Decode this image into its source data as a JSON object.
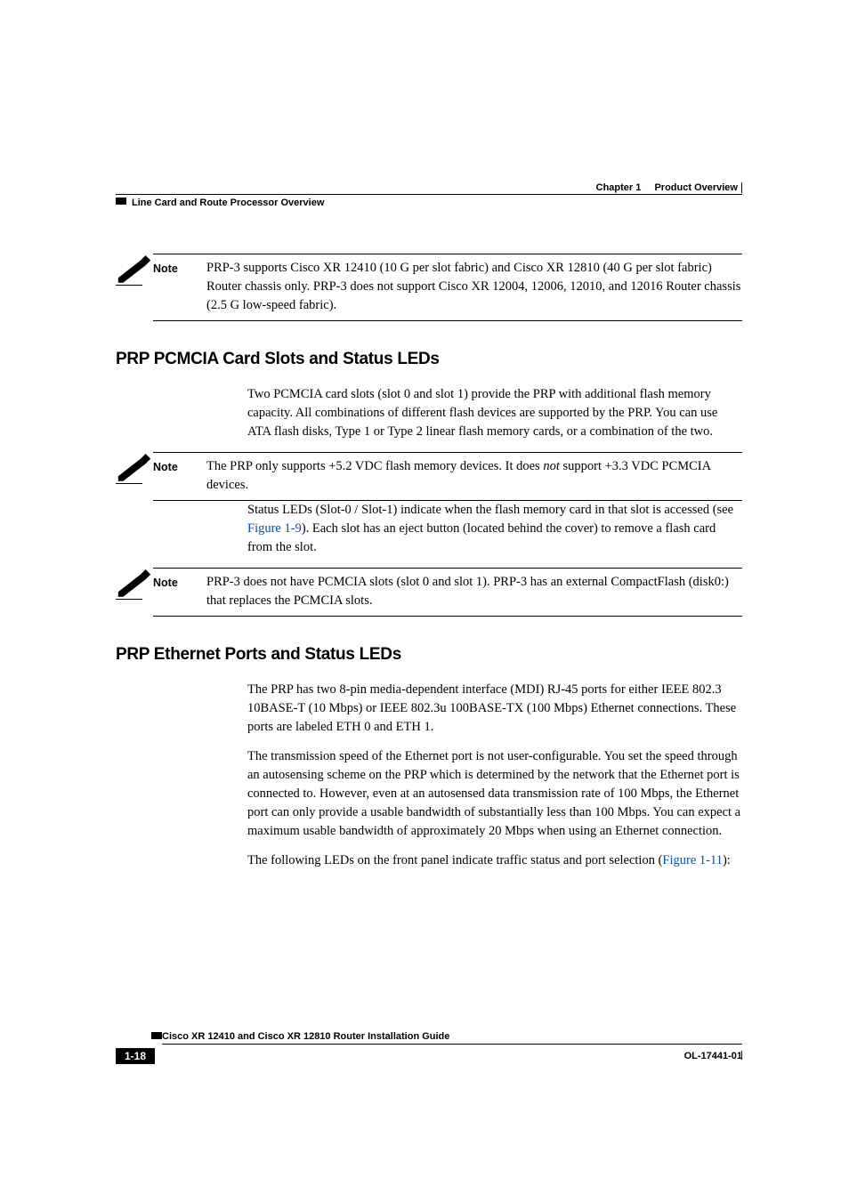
{
  "header": {
    "chapter_label": "Chapter 1",
    "chapter_title": "Product Overview",
    "section_left": "Line Card and Route Processor Overview"
  },
  "notes": {
    "note_label": "Note",
    "note1_text": "PRP-3 supports Cisco XR 12410 (10 G per slot fabric) and Cisco XR 12810 (40 G per slot fabric) Router chassis only. PRP-3 does not support Cisco XR 12004, 12006, 12010, and 12016 Router chassis (2.5 G low-speed fabric).",
    "note2_text_a": "The PRP only supports +5.2 VDC flash memory devices. It does ",
    "note2_text_ital": "not",
    "note2_text_b": " support +3.3 VDC PCMCIA devices.",
    "note3_text": "PRP-3 does not have PCMCIA slots (slot 0 and slot 1). PRP-3 has an external CompactFlash (disk0:) that replaces the PCMCIA slots."
  },
  "sections": {
    "pcmcia_heading": "PRP PCMCIA Card Slots and Status LEDs",
    "pcmcia_para1": "Two PCMCIA card slots (slot 0 and slot 1) provide the PRP with additional flash memory capacity. All combinations of different flash devices are supported by the PRP. You can use ATA flash disks, Type 1 or Type 2 linear flash memory cards, or a combination of the two.",
    "pcmcia_para2_a": "Status LEDs (Slot-0 / Slot-1) indicate when the flash memory card in that slot is accessed (see ",
    "pcmcia_para2_link": "Figure 1-9",
    "pcmcia_para2_b": "). Each slot has an eject button (located behind the cover) to remove a flash card from the slot.",
    "eth_heading": "PRP Ethernet Ports and Status LEDs",
    "eth_para1": "The PRP has two 8-pin media-dependent interface (MDI) RJ-45 ports for either IEEE 802.3 10BASE-T (10 Mbps) or IEEE 802.3u 100BASE-TX (100 Mbps) Ethernet connections. These ports are labeled ETH 0 and ETH 1.",
    "eth_para2": "The transmission speed of the Ethernet port is not user-configurable. You set the speed through an autosensing scheme on the PRP which is determined by the network that the Ethernet port is connected to. However, even at an autosensed data transmission rate of 100 Mbps, the Ethernet port can only provide a usable bandwidth of substantially less than 100 Mbps. You can expect a maximum usable bandwidth of approximately 20 Mbps when using an Ethernet connection.",
    "eth_para3_a": "The following LEDs on the front panel indicate traffic status and port selection (",
    "eth_para3_link": "Figure 1-11",
    "eth_para3_b": "):"
  },
  "footer": {
    "guide_title": "Cisco XR 12410 and Cisco XR 12810 Router Installation Guide",
    "page_num": "1-18",
    "doc_num": "OL-17441-01"
  }
}
